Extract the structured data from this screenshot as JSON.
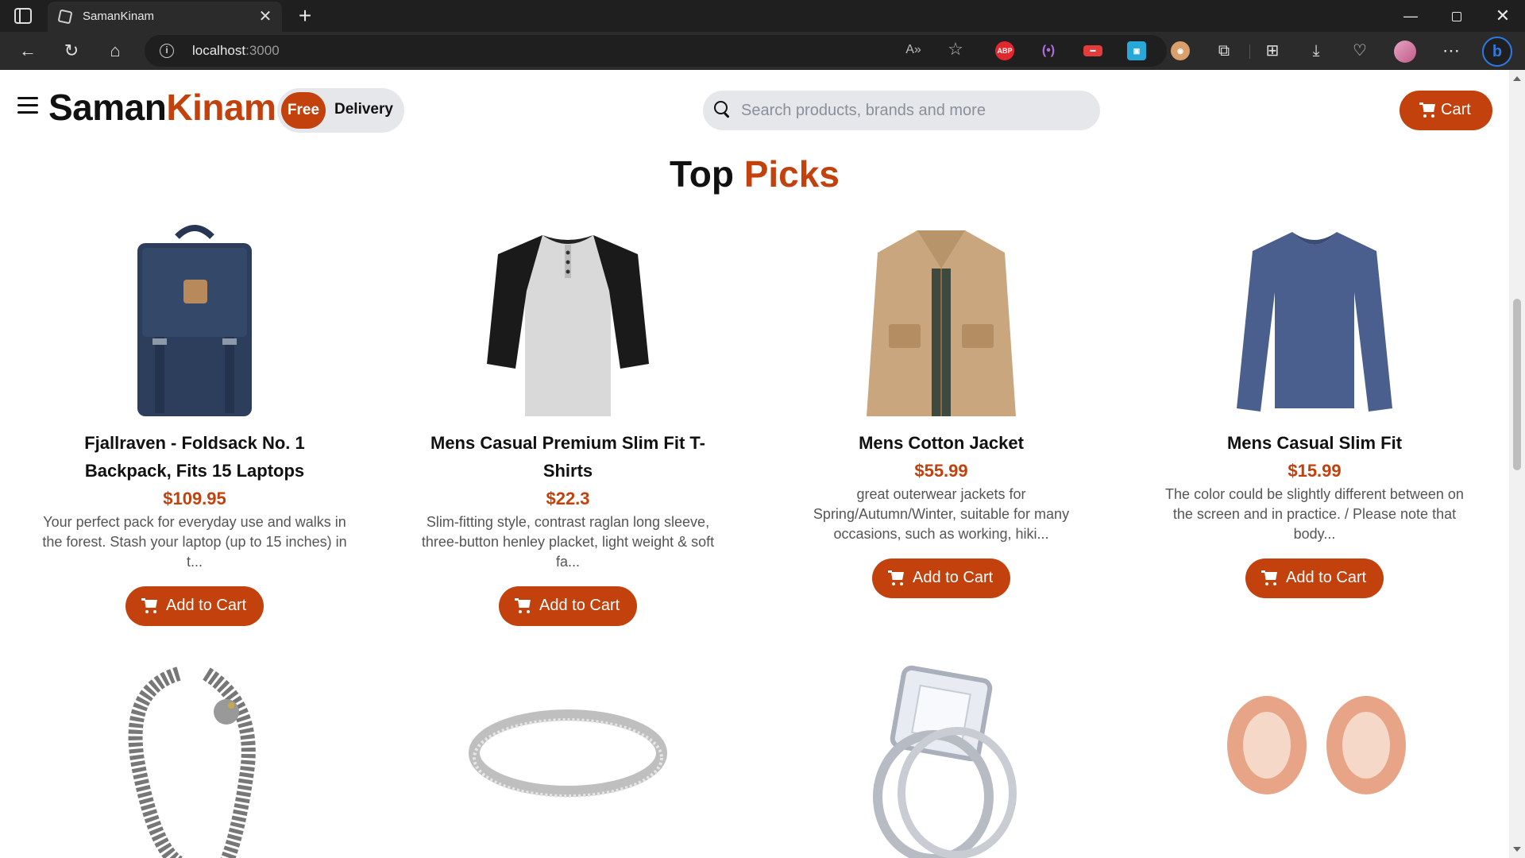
{
  "browser": {
    "tab_title": "SamanKinam",
    "url_host": "localhost",
    "url_port": ":3000"
  },
  "header": {
    "logo_part1": "Saman",
    "logo_part2": "Kinam",
    "free_badge": "Free",
    "delivery_text": "Delivery",
    "search_placeholder": "Search products, brands and more",
    "search_value": "",
    "cart_label": "Cart",
    "accent_color": "#c2410c"
  },
  "section": {
    "title_part1": "Top",
    "title_part2": "Picks"
  },
  "products": [
    {
      "title": "Fjallraven - Foldsack No. 1 Backpack, Fits 15 Laptops",
      "price": "$109.95",
      "description": "Your perfect pack for everyday use and walks in the forest. Stash your laptop (up to 15 inches) in t...",
      "button": "Add to Cart",
      "icon": "backpack-image"
    },
    {
      "title": "Mens Casual Premium Slim Fit T-Shirts",
      "price": "$22.3",
      "description": "Slim-fitting style, contrast raglan long sleeve, three-button henley placket, light weight & soft fa...",
      "button": "Add to Cart",
      "icon": "tshirt-image"
    },
    {
      "title": "Mens Cotton Jacket",
      "price": "$55.99",
      "description": "great outerwear jackets for Spring/Autumn/Winter, suitable for many occasions, such as working, hiki...",
      "button": "Add to Cart",
      "icon": "jacket-image"
    },
    {
      "title": "Mens Casual Slim Fit",
      "price": "$15.99",
      "description": "The color could be slightly different between on the screen and in practice. / Please note that body...",
      "button": "Add to Cart",
      "icon": "longsleeve-image"
    }
  ],
  "second_row": [
    {
      "icon": "bracelet-image"
    },
    {
      "icon": "silver-ring-image"
    },
    {
      "icon": "diamond-ring-image"
    },
    {
      "icon": "rose-gold-plugs-image"
    }
  ]
}
